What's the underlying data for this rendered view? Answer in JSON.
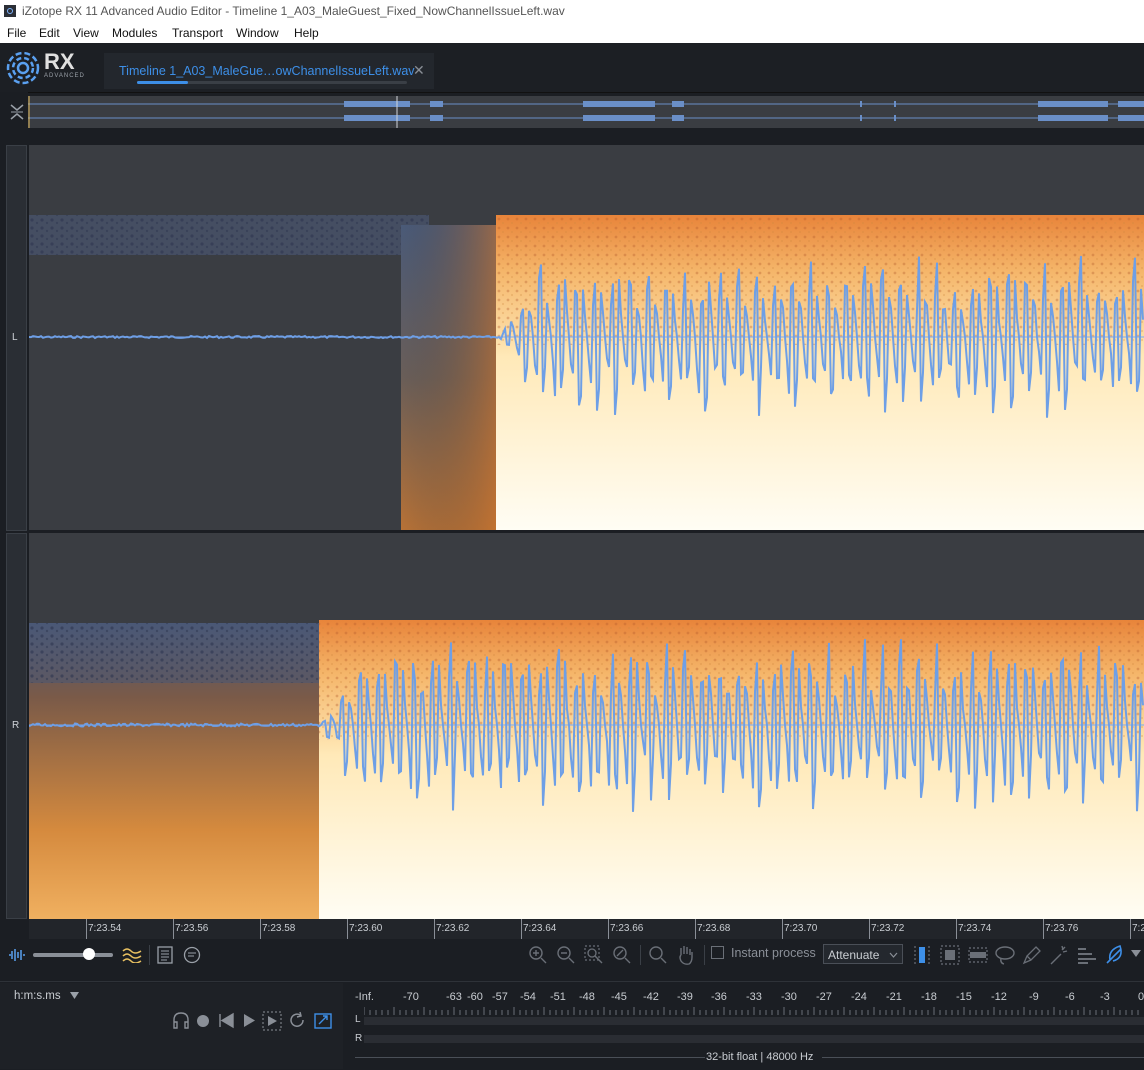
{
  "window": {
    "title": "iZotope RX 11 Advanced Audio Editor - Timeline 1_A03_MaleGuest_Fixed_NowChannelIssueLeft.wav"
  },
  "menu": [
    "File",
    "Edit",
    "View",
    "Modules",
    "Transport",
    "Window",
    "Help"
  ],
  "logo": {
    "text": "RX",
    "subtext": "ADVANCED"
  },
  "tab": {
    "label": "Timeline 1_A03_MaleGue…owChannelIssueLeft.wav",
    "close": "✕",
    "progress": 0.19
  },
  "channels": {
    "left": "L",
    "right": "R"
  },
  "ruler": {
    "labels": [
      "7:23.54",
      "7:23.56",
      "7:23.58",
      "7:23.60",
      "7:23.62",
      "7:23.64",
      "7:23.66",
      "7:23.68",
      "7:23.70",
      "7:23.72",
      "7:23.74",
      "7:23.76",
      "7:2"
    ]
  },
  "toolbar": {
    "instant_process": "Instant process",
    "mode": "Attenuate",
    "zoom_level": 0.7
  },
  "time_format": "h:m:s.ms",
  "meter": {
    "scale": [
      "-Inf.",
      "-70",
      "-63",
      "-60",
      "-57",
      "-54",
      "-51",
      "-48",
      "-45",
      "-42",
      "-39",
      "-36",
      "-33",
      "-30",
      "-27",
      "-24",
      "-21",
      "-18",
      "-15",
      "-12",
      "-9",
      "-6",
      "-3",
      "0"
    ],
    "channels": [
      "L",
      "R"
    ],
    "info": "32-bit float | 48000 Hz"
  },
  "colors": {
    "accent": "#3d8fe8",
    "waveform": "#6e9fe6",
    "background": "#1b1e23"
  }
}
